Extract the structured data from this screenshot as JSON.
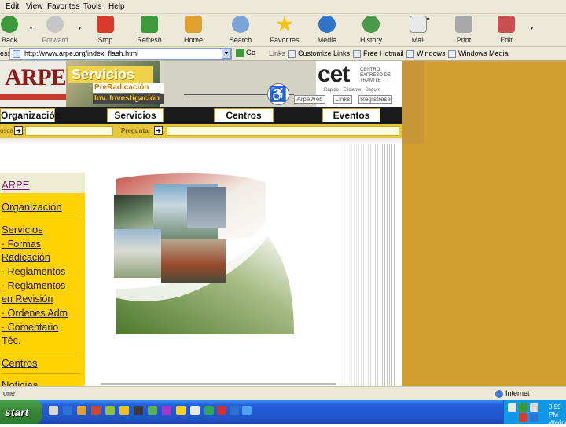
{
  "menu": [
    "Edit",
    "View",
    "Favorites",
    "Tools",
    "Help"
  ],
  "toolbar": [
    {
      "label": "Back",
      "icon": "back-arrow-icon",
      "color": "#3c9a3c"
    },
    {
      "label": "Forward",
      "icon": "forward-arrow-icon",
      "color": "#b9b9b9"
    },
    {
      "label": "Stop",
      "icon": "stop-icon",
      "color": "#d83b2b"
    },
    {
      "label": "Refresh",
      "icon": "refresh-icon",
      "color": "#3c9a3c"
    },
    {
      "label": "Home",
      "icon": "home-icon",
      "color": "#e0a030"
    },
    {
      "label": "Search",
      "icon": "search-icon",
      "color": "#7aa4d8"
    },
    {
      "label": "Favorites",
      "icon": "star-icon",
      "color": "#f1c40f"
    },
    {
      "label": "Media",
      "icon": "media-icon",
      "color": "#2f74c9"
    },
    {
      "label": "History",
      "icon": "history-icon",
      "color": "#4a9a4a"
    },
    {
      "label": "Mail",
      "icon": "mail-icon",
      "color": "#dcdcdc"
    },
    {
      "label": "Print",
      "icon": "printer-icon",
      "color": "#9a9a9a"
    },
    {
      "label": "Edit",
      "icon": "edit-icon",
      "color": "#c85050"
    }
  ],
  "address": {
    "label": "ess",
    "url": "http://www.arpe.org/index_flash.html",
    "go": "Go"
  },
  "links_bar": {
    "label": "Links",
    "items": [
      "Customize Links",
      "Free Hotmail",
      "Windows",
      "Windows Media"
    ]
  },
  "site": {
    "logo": "ARPE",
    "servicios_title": "Servicios",
    "preradicacion": "PreRadicación",
    "investigacion": "Inv. Investigación",
    "cet_logo": "cet",
    "cet_tag": "CENTRO EXPRESO DE TRAMITE",
    "cet_sub": "Rápido · Eficiente · Seguro",
    "mini_links": [
      "ArpeWeb",
      "Links",
      "Regístrese"
    ],
    "nav": [
      "Organización",
      "Servicios",
      "Centros",
      "Eventos"
    ],
    "search_label": "usca",
    "pregunta_label": "Pregunta"
  },
  "leftnav": [
    "ARPE",
    "Organización",
    "Servicios",
    "· Formas",
    "Radicación",
    "· Reglamentos",
    "· Reglamentos",
    "en Revisión",
    "· Ordenes Adm",
    "· Comentario",
    "Téc.",
    "Centros",
    "Noticias"
  ],
  "status": {
    "text": "one",
    "zone": "Internet"
  },
  "taskbar": {
    "start": "start",
    "time": "9:59 PM",
    "day": "Wednes"
  }
}
